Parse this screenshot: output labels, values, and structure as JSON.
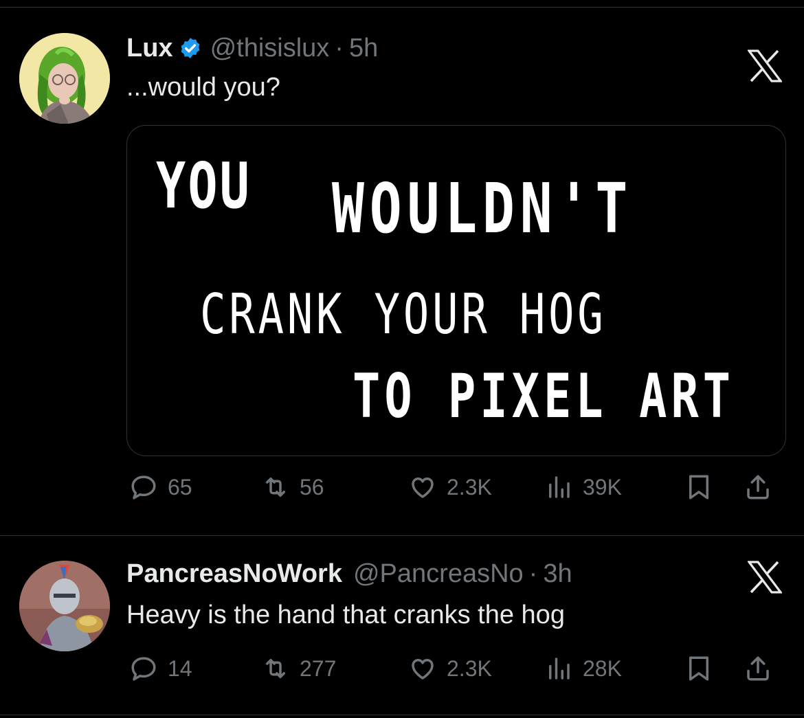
{
  "tweets": [
    {
      "name": "Lux",
      "handle": "@thisislux",
      "separator": "·",
      "time": "5h",
      "text": "...would you?",
      "verified": true,
      "media": {
        "line1": "YOU",
        "line1b": "WOULDN'T",
        "line2": "CRANK YOUR HOG",
        "line3": "TO PIXEL ART"
      },
      "stats": {
        "replies": "65",
        "reposts": "56",
        "likes": "2.3K",
        "views": "39K"
      }
    },
    {
      "name": "PancreasNoWork",
      "handle": "@PancreasNo",
      "separator": "·",
      "time": "3h",
      "text": "Heavy is the hand that cranks the hog",
      "verified": false,
      "stats": {
        "replies": "14",
        "reposts": "277",
        "likes": "2.3K",
        "views": "28K"
      }
    }
  ],
  "icons": {
    "reply": "speech-bubble-icon",
    "repost": "repost-arrows-icon",
    "like": "heart-icon",
    "views": "bar-chart-icon",
    "bookmark": "bookmark-icon",
    "share": "share-upload-icon",
    "platform": "x-logo-icon",
    "verified": "verified-badge-icon"
  },
  "colors": {
    "background": "#000000",
    "text": "#e7e9ea",
    "muted": "#71767b",
    "verified": "#1d9bf0",
    "divider": "#2f3336"
  }
}
